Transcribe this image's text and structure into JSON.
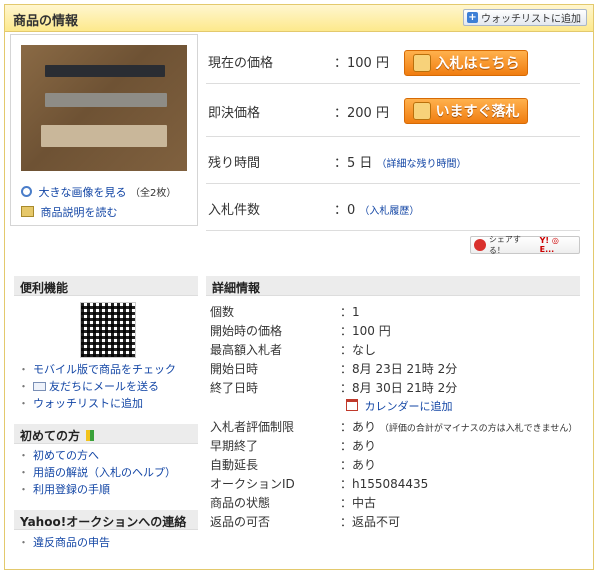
{
  "header": {
    "title": "商品の情報",
    "watchlist_button": "ウォッチリストに追加"
  },
  "image_panel": {
    "enlarge_link": "大きな画像を見る",
    "enlarge_count": "（全2枚）",
    "description_link": "商品説明を読む"
  },
  "price_rows": {
    "current_price": {
      "label": "現在の価格",
      "value": "：100 円",
      "button": "入札はこちら"
    },
    "buyout_price": {
      "label": "即決価格",
      "value": "：200 円",
      "button": "いますぐ落札"
    },
    "time_left": {
      "label": "残り時間",
      "value": "：5 日",
      "link": "（詳細な残り時間）"
    },
    "bid_count": {
      "label": "入札件数",
      "value": "：0",
      "link": "（入札履歴）"
    }
  },
  "share": {
    "label": "シェアする！",
    "services": "Y! ◎ E..."
  },
  "sidebar": {
    "convenient": {
      "title": "便利機能",
      "links": [
        "モバイル版で商品をチェック",
        "友だちにメールを送る",
        "ウォッチリストに追加"
      ]
    },
    "beginners": {
      "title": "初めての方",
      "links": [
        "初めての方へ",
        "用語の解説（入札のヘルプ）",
        "利用登録の手順"
      ]
    },
    "contact": {
      "title": "Yahoo!オークションへの連絡",
      "links": [
        "違反商品の申告"
      ]
    }
  },
  "details": {
    "title": "詳細情報",
    "rows": [
      {
        "label": "個数",
        "value": "：1"
      },
      {
        "label": "開始時の価格",
        "value": "：100 円"
      },
      {
        "label": "最高額入札者",
        "value": "：なし"
      },
      {
        "label": "開始日時",
        "value": "：8月 23日 21時 2分"
      },
      {
        "label": "終了日時",
        "value": "：8月 30日 21時 2分"
      },
      {
        "label": "入札者評価制限",
        "value": "：あり",
        "note": "（評価の合計がマイナスの方は入札できません）"
      },
      {
        "label": "早期終了",
        "value": "：あり"
      },
      {
        "label": "自動延長",
        "value": "：あり"
      },
      {
        "label": "オークションID",
        "value": "：h155084435"
      },
      {
        "label": "商品の状態",
        "value": "：中古"
      },
      {
        "label": "返品の可否",
        "value": "：返品不可"
      }
    ],
    "calendar_link": "カレンダーに追加"
  }
}
